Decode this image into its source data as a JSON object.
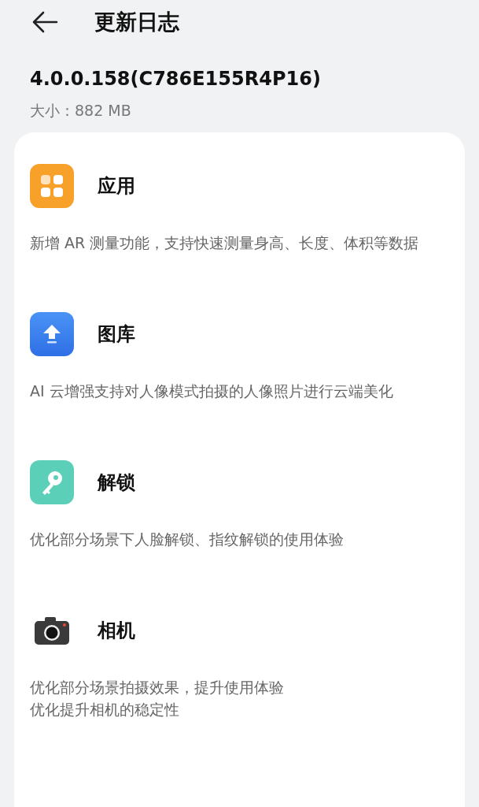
{
  "header": {
    "title": "更新日志"
  },
  "version": "4.0.0.158(C786E155R4P16)",
  "size": "大小：882 MB",
  "sections": [
    {
      "kind": "apps",
      "title": "应用",
      "lines": [
        "新增 AR 测量功能，支持快速测量身高、长度、体积等数据"
      ]
    },
    {
      "kind": "gallery",
      "title": "图库",
      "lines": [
        "AI 云增强支持对人像模式拍摄的人像照片进行云端美化"
      ]
    },
    {
      "kind": "unlock",
      "title": "解锁",
      "lines": [
        "优化部分场景下人脸解锁、指纹解锁的使用体验"
      ]
    },
    {
      "kind": "camera",
      "title": "相机",
      "lines": [
        "优化部分场景拍摄效果，提升使用体验",
        "优化提升相机的稳定性"
      ]
    }
  ]
}
